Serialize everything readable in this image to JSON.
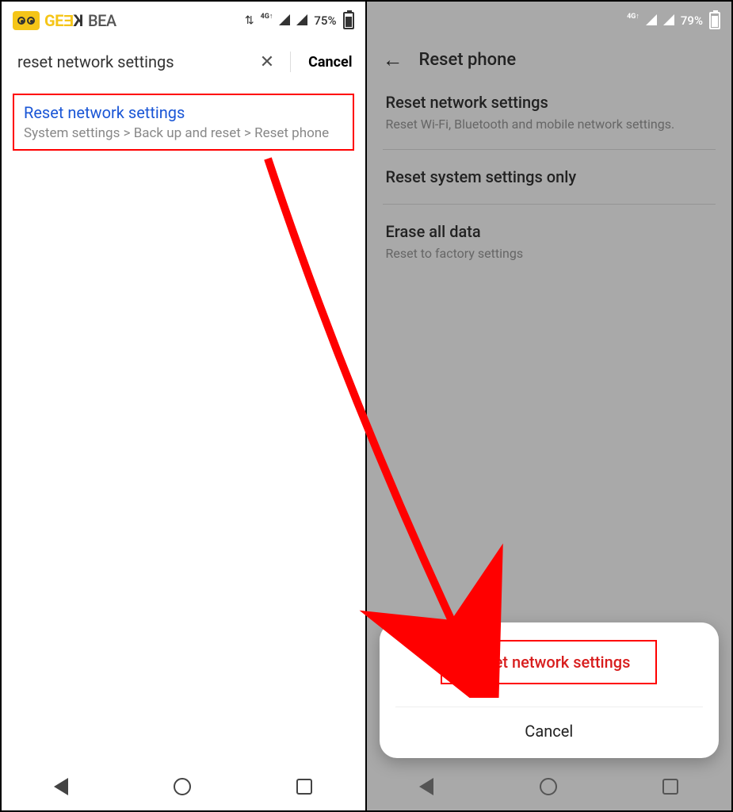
{
  "left": {
    "logo_text_ge": "GE",
    "logo_text_reversed_e": "Ǝ",
    "logo_text_k": "K",
    "logo_text_bea": "BEA",
    "status": {
      "net_label": "4G↑",
      "battery_pct": "75%"
    },
    "search": {
      "query": "reset network settings",
      "cancel": "Cancel"
    },
    "result": {
      "title": "Reset network settings",
      "path": "System settings > Back up and reset > Reset phone"
    }
  },
  "right": {
    "status": {
      "net_label": "4G↑",
      "battery_pct": "79%"
    },
    "header": {
      "title": "Reset phone"
    },
    "items": [
      {
        "t": "Reset network settings",
        "s": "Reset Wi-Fi, Bluetooth and mobile network settings."
      },
      {
        "t": "Reset system settings only",
        "s": ""
      },
      {
        "t": "Erase all data",
        "s": "Reset to factory settings"
      }
    ],
    "sheet": {
      "confirm": "Reset network settings",
      "cancel": "Cancel"
    }
  }
}
